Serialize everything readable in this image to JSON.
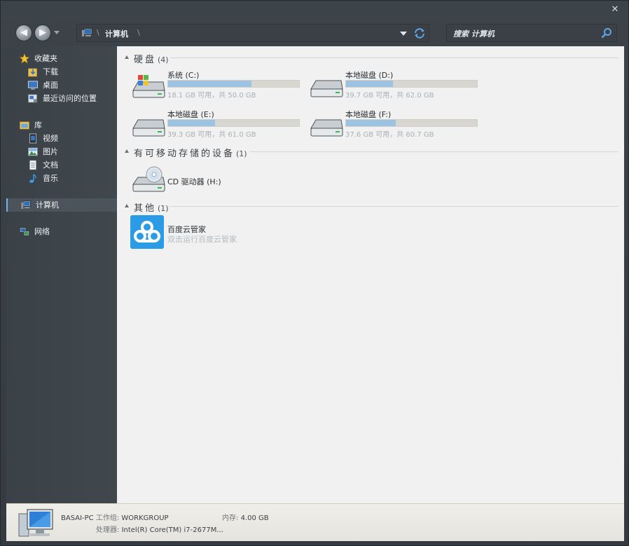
{
  "window": {
    "close_glyph": "✕"
  },
  "toolbar": {
    "back_glyph": "◀",
    "forward_glyph": "▶",
    "address": {
      "current": "计算机",
      "sep": "\\"
    },
    "search": {
      "placeholder": "搜索 计算机"
    }
  },
  "sidebar": {
    "favorites": {
      "label": "收藏夹",
      "items": [
        "下载",
        "桌面",
        "最近访问的位置"
      ]
    },
    "libraries": {
      "label": "库",
      "items": [
        "视频",
        "图片",
        "文档",
        "音乐"
      ]
    },
    "computer": {
      "label": "计算机"
    },
    "network": {
      "label": "网络"
    }
  },
  "groups": [
    {
      "title": "硬盘",
      "count": "(4)"
    },
    {
      "title": "有可移动存储的设备",
      "count": "(1)"
    },
    {
      "title": "其他",
      "count": "(1)"
    }
  ],
  "drives": [
    {
      "name": "系统 (C:)",
      "free": "18.1 GB 可用，共 50.0 GB",
      "used_fraction": 0.638,
      "type": "system"
    },
    {
      "name": "本地磁盘 (D:)",
      "free": "39.7 GB 可用，共 62.0 GB",
      "used_fraction": 0.36,
      "type": "hdd"
    },
    {
      "name": "本地磁盘 (E:)",
      "free": "39.3 GB 可用，共 61.0 GB",
      "used_fraction": 0.356,
      "type": "hdd"
    },
    {
      "name": "本地磁盘 (F:)",
      "free": "37.6 GB 可用，共 60.7 GB",
      "used_fraction": 0.38,
      "type": "hdd"
    }
  ],
  "removable": [
    {
      "name": "CD 驱动器 (H:)"
    }
  ],
  "other": [
    {
      "name": "百度云管家",
      "desc": "双击运行百度云管家"
    }
  ],
  "details": {
    "computer_name": "BASAI-PC",
    "workgroup_label": "工作组:",
    "workgroup": "WORKGROUP",
    "memory_label": "内存:",
    "memory": "4.00 GB",
    "cpu_label": "处理器:",
    "cpu": "Intel(R) Core(TM) i7-2677M..."
  },
  "colors": {
    "accent": "#6fb3ea",
    "drive_fill": "#9cc3e2",
    "app_icon": "#2b9be6"
  }
}
